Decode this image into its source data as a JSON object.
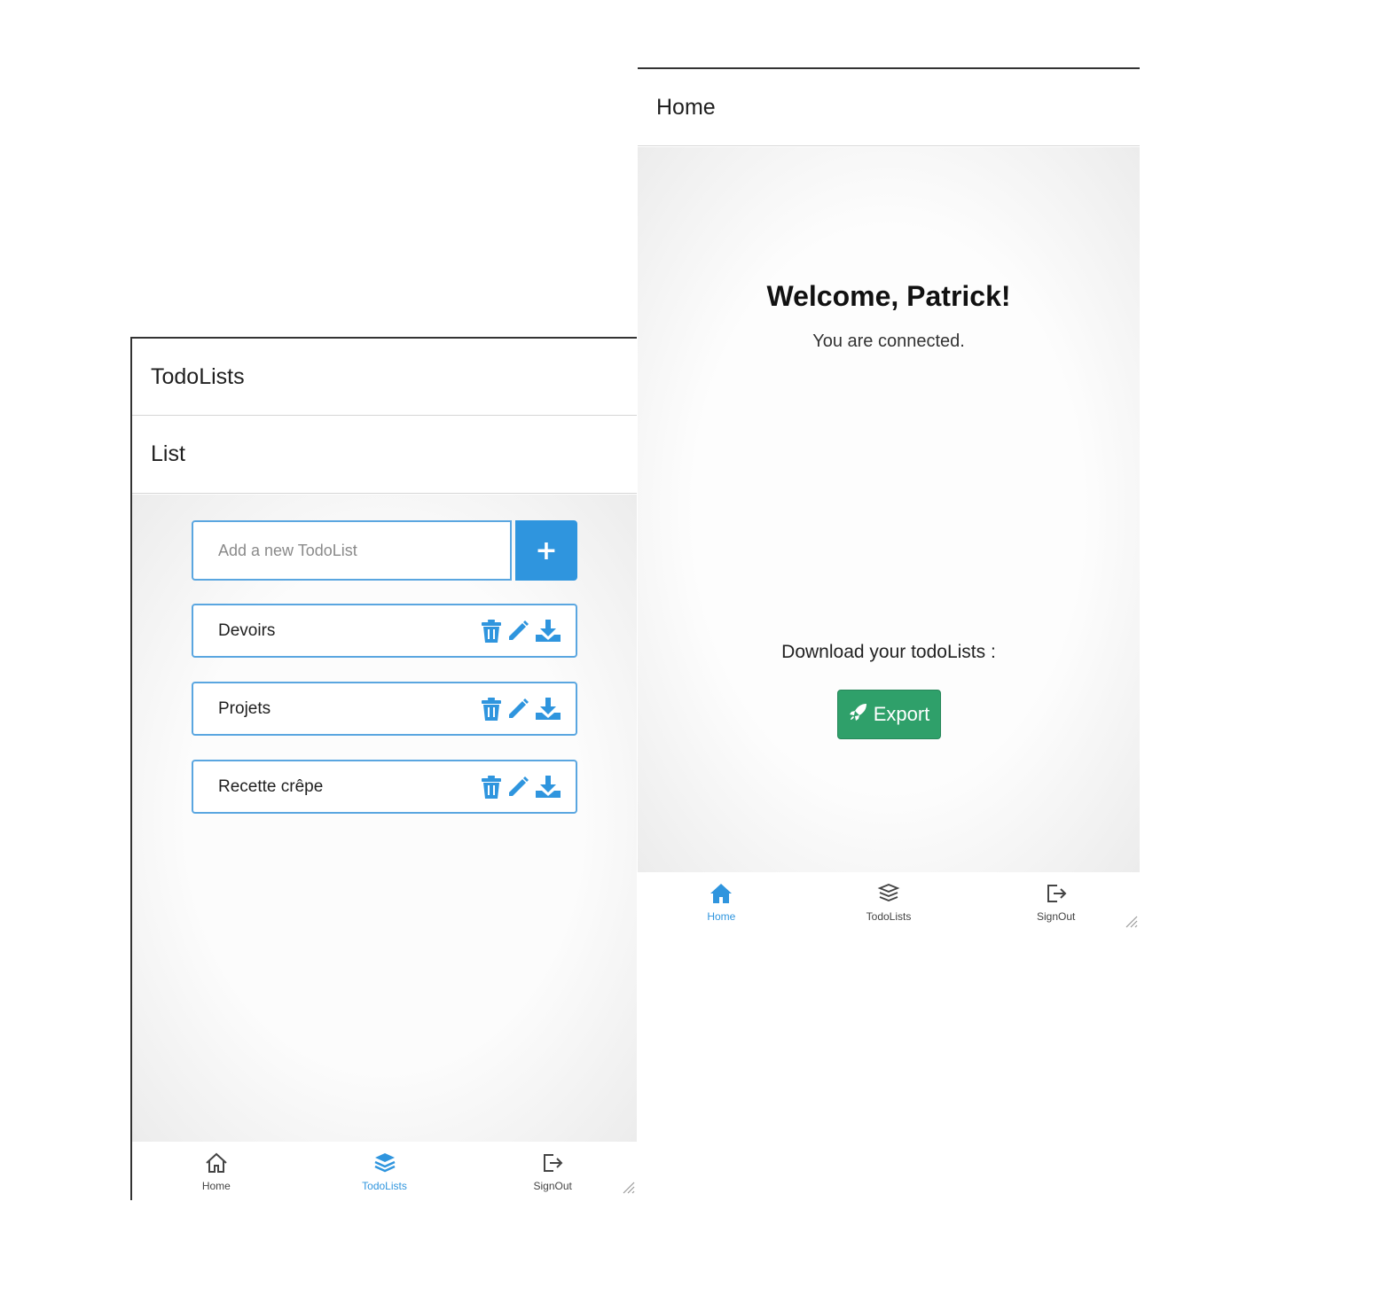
{
  "todolists_screen": {
    "title": "TodoLists",
    "subtitle": "List",
    "input_placeholder": "Add a new TodoList",
    "add_button": "+",
    "items": [
      {
        "name": "Devoirs"
      },
      {
        "name": "Projets"
      },
      {
        "name": "Recette crêpe"
      }
    ],
    "tabs": [
      {
        "label": "Home",
        "icon": "home-icon",
        "active": false
      },
      {
        "label": "TodoLists",
        "icon": "layers-icon",
        "active": true
      },
      {
        "label": "SignOut",
        "icon": "sign-out-icon",
        "active": false
      }
    ]
  },
  "home_screen": {
    "title": "Home",
    "welcome": "Welcome, Patrick!",
    "status": "You are connected.",
    "download_label": "Download your todoLists :",
    "export_button": "Export",
    "tabs": [
      {
        "label": "Home",
        "icon": "home-icon",
        "active": true
      },
      {
        "label": "TodoLists",
        "icon": "layers-icon",
        "active": false
      },
      {
        "label": "SignOut",
        "icon": "sign-out-icon",
        "active": false
      }
    ]
  },
  "colors": {
    "accent": "#2f95de",
    "border": "#5aa6e0",
    "success": "#2fa06a"
  }
}
